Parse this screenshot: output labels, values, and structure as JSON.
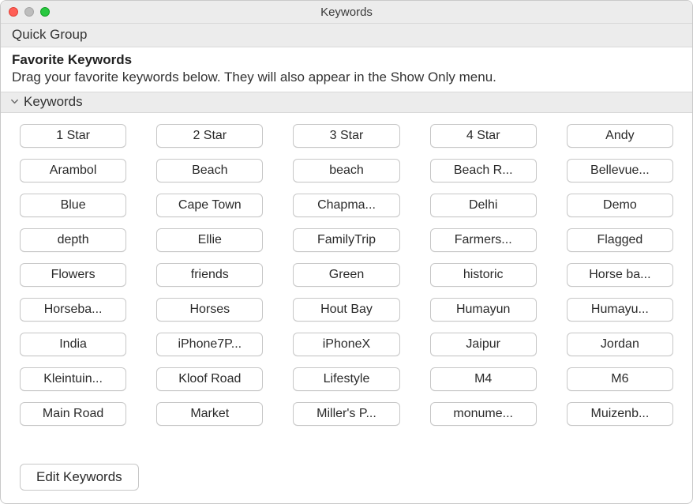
{
  "window": {
    "title": "Keywords"
  },
  "quick_group": {
    "label": "Quick Group"
  },
  "favorites": {
    "heading": "Favorite Keywords",
    "subtext": "Drag your favorite keywords below. They will also appear in the Show Only menu."
  },
  "keywords_section": {
    "label": "Keywords"
  },
  "keywords": [
    "1 Star",
    "2 Star",
    "3 Star",
    "4 Star",
    "Andy",
    "Arambol",
    "Beach",
    "beach",
    "Beach R...",
    "Bellevue...",
    "Blue",
    "Cape Town",
    "Chapma...",
    "Delhi",
    "Demo",
    "depth",
    "Ellie",
    "FamilyTrip",
    "Farmers...",
    "Flagged",
    "Flowers",
    "friends",
    "Green",
    "historic",
    "Horse ba...",
    "Horseba...",
    "Horses",
    "Hout Bay",
    "Humayun",
    "Humayu...",
    "India",
    "iPhone7P...",
    "iPhoneX",
    "Jaipur",
    "Jordan",
    "Kleintuin...",
    "Kloof Road",
    "Lifestyle",
    "M4",
    "M6",
    "Main Road",
    "Market",
    "Miller's P...",
    "monume...",
    "Muizenb..."
  ],
  "footer": {
    "edit_label": "Edit Keywords"
  }
}
